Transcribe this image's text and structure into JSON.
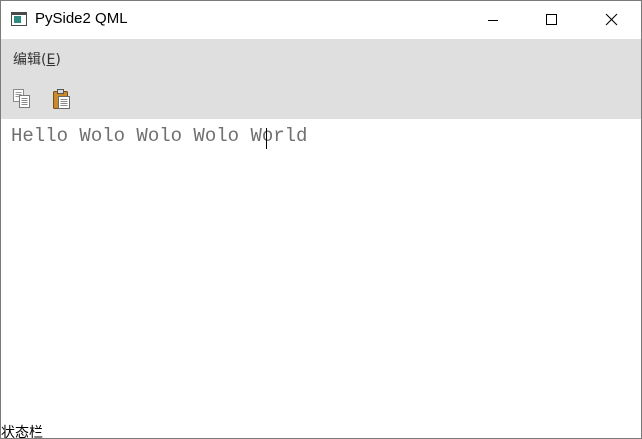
{
  "window": {
    "title": "PySide2 QML",
    "app_icon": "window-app-icon",
    "controls": {
      "minimize_icon": "minimize-icon",
      "maximize_icon": "maximize-icon",
      "close_icon": "close-icon"
    }
  },
  "menubar": {
    "edit_menu": {
      "label_prefix": "编辑(",
      "mnemonic": "E",
      "label_suffix": ")"
    }
  },
  "toolbar": {
    "copy_icon": "copy-icon",
    "paste_icon": "paste-icon"
  },
  "editor": {
    "text_before_cursor": "Hello Wolo Wolo Wolo Wo",
    "text_after_cursor": "rld"
  },
  "statusbar": {
    "text": "状态栏"
  },
  "colors": {
    "chrome_background": "#dfdfdf",
    "editor_text": "#707070",
    "app_icon_accent": "#2e8b82"
  }
}
